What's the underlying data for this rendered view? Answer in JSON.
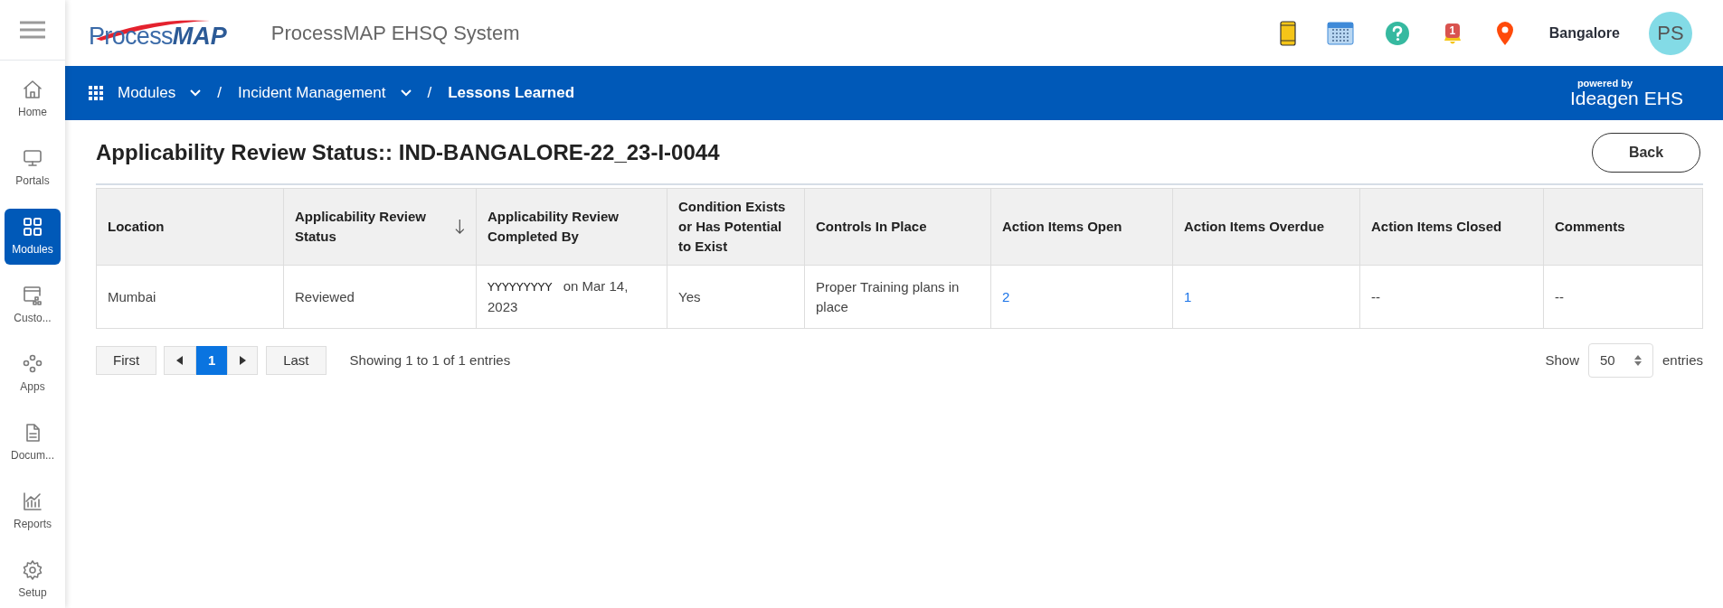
{
  "header": {
    "logo": {
      "light": "Process",
      "bold": "MAP"
    },
    "app_title": "ProcessMAP EHSQ System",
    "notification_count": "1",
    "location": "Bangalore",
    "avatar": "PS"
  },
  "breadcrumb_separator": "/",
  "breadcrumb": [
    {
      "label": "Modules",
      "dropdown": true,
      "kind": "grid"
    },
    {
      "label": "Incident Management",
      "dropdown": true,
      "kind": "plain"
    },
    {
      "label": "Lessons Learned",
      "dropdown": false,
      "kind": "plain"
    }
  ],
  "powered_by": {
    "caption": "powered by",
    "brand": "Ideagen",
    "product": "EHS"
  },
  "sidebar": {
    "items": [
      {
        "label": "Home",
        "selected": false
      },
      {
        "label": "Portals",
        "selected": false
      },
      {
        "label": "Modules",
        "selected": true
      },
      {
        "label": "Custo...",
        "selected": false
      },
      {
        "label": "Apps",
        "selected": false
      },
      {
        "label": "Docum...",
        "selected": false
      },
      {
        "label": "Reports",
        "selected": false
      },
      {
        "label": "Setup",
        "selected": false
      }
    ]
  },
  "page_title": "Applicability Review Status:: IND-BANGALORE-22_23-I-0044",
  "back_button": "Back",
  "table": {
    "columns": [
      {
        "label": "Location",
        "sorted": false
      },
      {
        "label": "Applicability Review Status",
        "sorted": true
      },
      {
        "label": "Applicability Review Completed By",
        "sorted": false
      },
      {
        "label": "Condition Exists or Has Potential to Exist",
        "sorted": false
      },
      {
        "label": "Controls In Place",
        "sorted": false
      },
      {
        "label": "Action Items Open",
        "sorted": false
      },
      {
        "label": "Action Items Overdue",
        "sorted": false
      },
      {
        "label": "Action Items Closed",
        "sorted": false
      },
      {
        "label": "Comments",
        "sorted": false
      }
    ],
    "rows": [
      [
        {
          "kind": "text",
          "text": "Mumbai"
        },
        {
          "kind": "text",
          "text": "Reviewed"
        },
        {
          "kind": "user_date",
          "user": "YYYYYYYYY",
          "text": "on Mar 14, 2023"
        },
        {
          "kind": "text",
          "text": "Yes"
        },
        {
          "kind": "text",
          "text": "Proper Training plans in place"
        },
        {
          "kind": "link",
          "text": "2"
        },
        {
          "kind": "link",
          "text": "1"
        },
        {
          "kind": "text",
          "text": "--"
        },
        {
          "kind": "text",
          "text": "--"
        }
      ]
    ]
  },
  "pagination": {
    "first": "First",
    "pages": [
      {
        "label": "1",
        "selected": true
      }
    ],
    "last": "Last",
    "summary": "Showing 1 to 1 of 1 entries",
    "show_label": "Show",
    "page_size": "50",
    "entries_label": "entries"
  }
}
